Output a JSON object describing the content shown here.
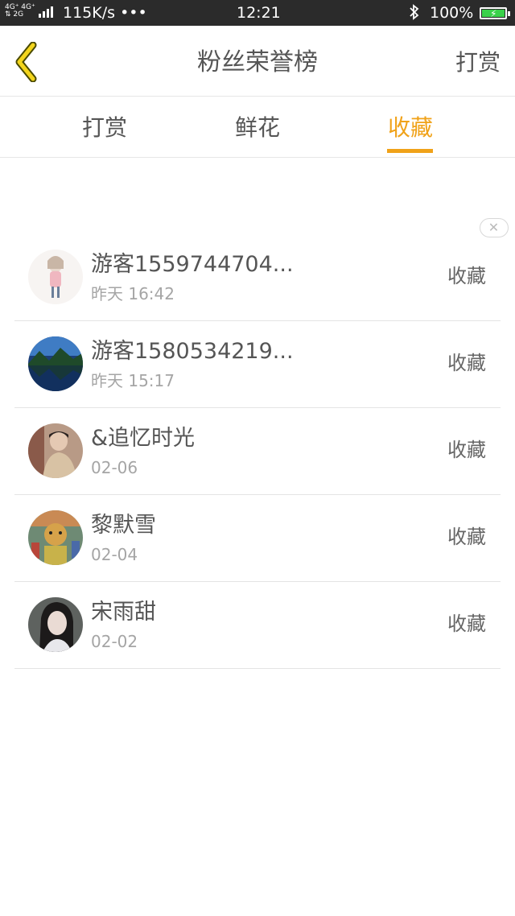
{
  "status_bar": {
    "network_top": "4G⁺ 4G⁺",
    "network_bottom": "⇅ 2G",
    "speed": "115K/s •••",
    "time": "12:21",
    "battery": "100%"
  },
  "header": {
    "title": "粉丝荣誉榜",
    "action": "打赏"
  },
  "tabs": [
    {
      "label": "打赏"
    },
    {
      "label": "鲜花"
    },
    {
      "label": "收藏"
    }
  ],
  "active_tab_color": "#f0a219",
  "close_symbol": "✕",
  "list": [
    {
      "name": "游客1559744704...",
      "date": "昨天 16:42",
      "action": "收藏"
    },
    {
      "name": "游客1580534219...",
      "date": "昨天 15:17",
      "action": "收藏"
    },
    {
      "name": "&追忆时光",
      "date": "02-06",
      "action": "收藏"
    },
    {
      "name": "黎默雪",
      "date": "02-04",
      "action": "收藏"
    },
    {
      "name": "宋雨甜",
      "date": "02-02",
      "action": "收藏"
    }
  ]
}
